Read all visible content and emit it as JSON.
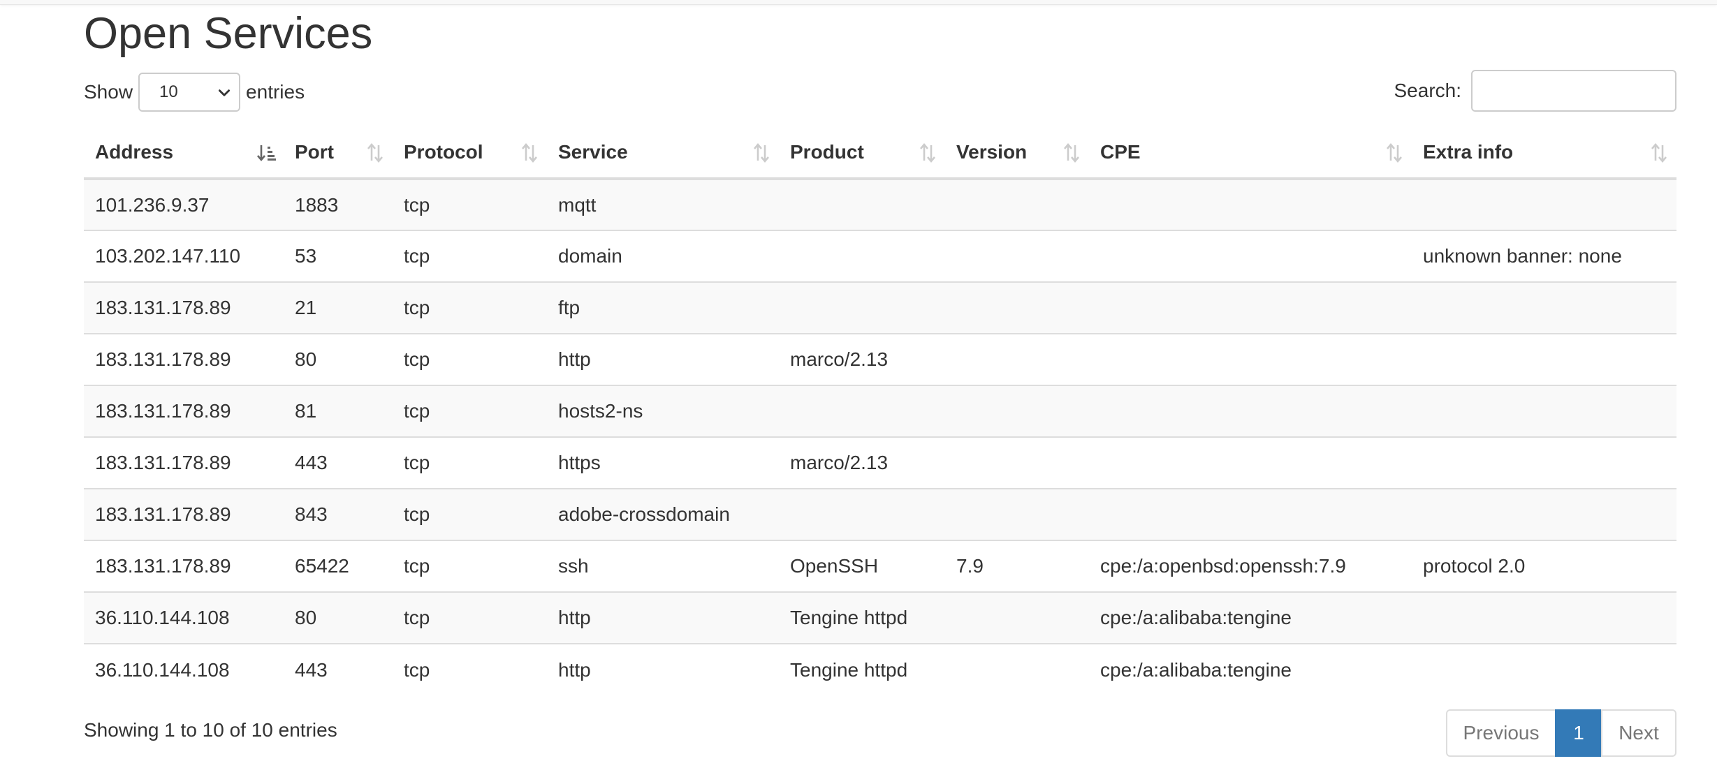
{
  "page": {
    "title": "Open Services"
  },
  "length": {
    "prefix": "Show",
    "selected": "10",
    "suffix": "entries"
  },
  "search": {
    "label": "Search:",
    "value": "",
    "placeholder": ""
  },
  "table": {
    "columns": [
      "Address",
      "Port",
      "Protocol",
      "Service",
      "Product",
      "Version",
      "CPE",
      "Extra info"
    ],
    "sorted_column": "Address",
    "rows": [
      [
        "101.236.9.37",
        "1883",
        "tcp",
        "mqtt",
        "",
        "",
        "",
        ""
      ],
      [
        "103.202.147.110",
        "53",
        "tcp",
        "domain",
        "",
        "",
        "",
        "unknown banner: none"
      ],
      [
        "183.131.178.89",
        "21",
        "tcp",
        "ftp",
        "",
        "",
        "",
        ""
      ],
      [
        "183.131.178.89",
        "80",
        "tcp",
        "http",
        "marco/2.13",
        "",
        "",
        ""
      ],
      [
        "183.131.178.89",
        "81",
        "tcp",
        "hosts2-ns",
        "",
        "",
        "",
        ""
      ],
      [
        "183.131.178.89",
        "443",
        "tcp",
        "https",
        "marco/2.13",
        "",
        "",
        ""
      ],
      [
        "183.131.178.89",
        "843",
        "tcp",
        "adobe-crossdomain",
        "",
        "",
        "",
        ""
      ],
      [
        "183.131.178.89",
        "65422",
        "tcp",
        "ssh",
        "OpenSSH",
        "7.9",
        "cpe:/a:openbsd:openssh:7.9",
        "protocol 2.0"
      ],
      [
        "36.110.144.108",
        "80",
        "tcp",
        "http",
        "Tengine httpd",
        "",
        "cpe:/a:alibaba:tengine",
        ""
      ],
      [
        "36.110.144.108",
        "443",
        "tcp",
        "http",
        "Tengine httpd",
        "",
        "cpe:/a:alibaba:tengine",
        ""
      ]
    ]
  },
  "footer": {
    "info": "Showing 1 to 10 of 10 entries",
    "previous": "Previous",
    "current_page": "1",
    "next": "Next"
  },
  "colors": {
    "accent": "#337ab7",
    "stripe": "#f9f9f9",
    "border": "#dddddd",
    "text": "#333333"
  }
}
